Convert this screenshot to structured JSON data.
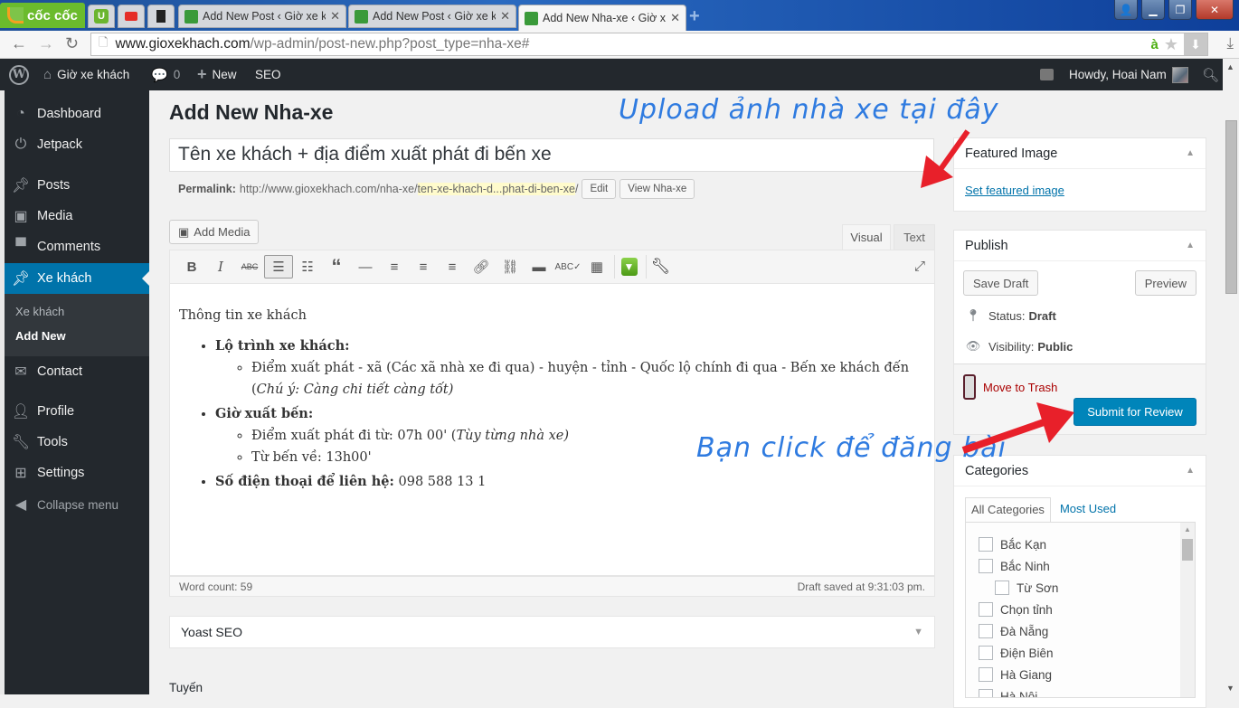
{
  "browser": {
    "brand": "cốc cốc",
    "tabs": [
      {
        "title": "Add New Post ‹ Giờ xe khách",
        "active": false
      },
      {
        "title": "Add New Post ‹ Giờ xe khách",
        "active": false
      },
      {
        "title": "Add New Nha-xe ‹ Giờ xe khách",
        "active": true
      }
    ],
    "pinned_tabs": [
      "U",
      "youtube",
      "bookmark"
    ],
    "url_host": "www.gioxekhach.com",
    "url_path": "/wp-admin/post-new.php?post_type=nha-xe#",
    "translit_badge": "à"
  },
  "adminbar": {
    "site_name": "Giờ xe khách",
    "comments_count": "0",
    "new_label": "New",
    "seo_label": "SEO",
    "howdy": "Howdy, Hoai Nam"
  },
  "sidebar": {
    "items": [
      {
        "label": "Dashboard",
        "icon": "dashboard-icon"
      },
      {
        "label": "Jetpack",
        "icon": "jetpack-icon"
      },
      {
        "label": "Posts",
        "icon": "pin-icon"
      },
      {
        "label": "Media",
        "icon": "media-icon"
      },
      {
        "label": "Comments",
        "icon": "comment-icon"
      },
      {
        "label": "Xe khách",
        "icon": "pin-icon",
        "current": true
      },
      {
        "label": "Contact",
        "icon": "mail-icon"
      },
      {
        "label": "Profile",
        "icon": "user-icon"
      },
      {
        "label": "Tools",
        "icon": "wrench-icon"
      },
      {
        "label": "Settings",
        "icon": "settings-icon"
      }
    ],
    "submenu": [
      "Xe khách",
      "Add New"
    ],
    "collapse": "Collapse menu"
  },
  "main": {
    "page_title": "Add New Nha-xe",
    "post_title": "Tên xe khách + địa điểm xuất phát đi bến xe",
    "permalink_label": "Permalink:",
    "permalink_base": "http://www.gioxekhach.com/nha-xe/",
    "permalink_slug": "ten-xe-khach-d...phat-di-ben-xe",
    "permalink_trail": "/",
    "edit_btn": "Edit",
    "view_btn": "View Nha-xe",
    "add_media": "Add Media",
    "tab_visual": "Visual",
    "tab_text": "Text",
    "content": {
      "intro": "Thông tin xe khách",
      "item1_title": "Lộ trình xe khách:",
      "item1_sub1": "Điểm xuất phát - xã (Các xã nhà xe đi qua) - huyện - tỉnh - Quốc lộ chính đi qua - Bến xe khách đến (",
      "item1_sub1_em": "Chú ý: Càng chi tiết càng tốt)",
      "item2_title": "Giờ xuất bến:",
      "item2_sub1": "Điểm xuất phát đi từ: 07h 00' (",
      "item2_sub1_em": "Tùy từng nhà xe)",
      "item2_sub2": "Từ bến về: 13h00'",
      "item3_title": "Số điện thoại để liên hệ:",
      "item3_value": " 098 588 13 1"
    },
    "word_count": "Word count: 59",
    "draft_saved": "Draft saved at 9:31:03 pm.",
    "yoast": "Yoast SEO",
    "next_section": "Tuyến"
  },
  "featured": {
    "title": "Featured Image",
    "link": "Set featured image"
  },
  "publish": {
    "title": "Publish",
    "save_draft": "Save Draft",
    "preview": "Preview",
    "status_label": "Status:",
    "status_value": "Draft",
    "visibility_label": "Visibility:",
    "visibility_value": "Public",
    "trash": "Move to Trash",
    "submit": "Submit for Review"
  },
  "categories": {
    "title": "Categories",
    "tab_all": "All Categories",
    "tab_most": "Most Used",
    "items": [
      {
        "label": "Bắc Kạn",
        "checked": false,
        "child": false
      },
      {
        "label": "Bắc Ninh",
        "checked": false,
        "child": false
      },
      {
        "label": "Từ Sơn",
        "checked": false,
        "child": true
      },
      {
        "label": "Chọn tỉnh",
        "checked": false,
        "child": false
      },
      {
        "label": "Đà Nẵng",
        "checked": false,
        "child": false
      },
      {
        "label": "Điện Biên",
        "checked": false,
        "child": false
      },
      {
        "label": "Hà Giang",
        "checked": false,
        "child": false
      },
      {
        "label": "Hà Nội",
        "checked": false,
        "child": false
      }
    ]
  },
  "annotations": {
    "upload": "Upload ảnh nhà xe tại đây",
    "click": "Bạn click để đăng bài",
    "color": "#2f7be0",
    "arrow_color": "#e8202a"
  }
}
